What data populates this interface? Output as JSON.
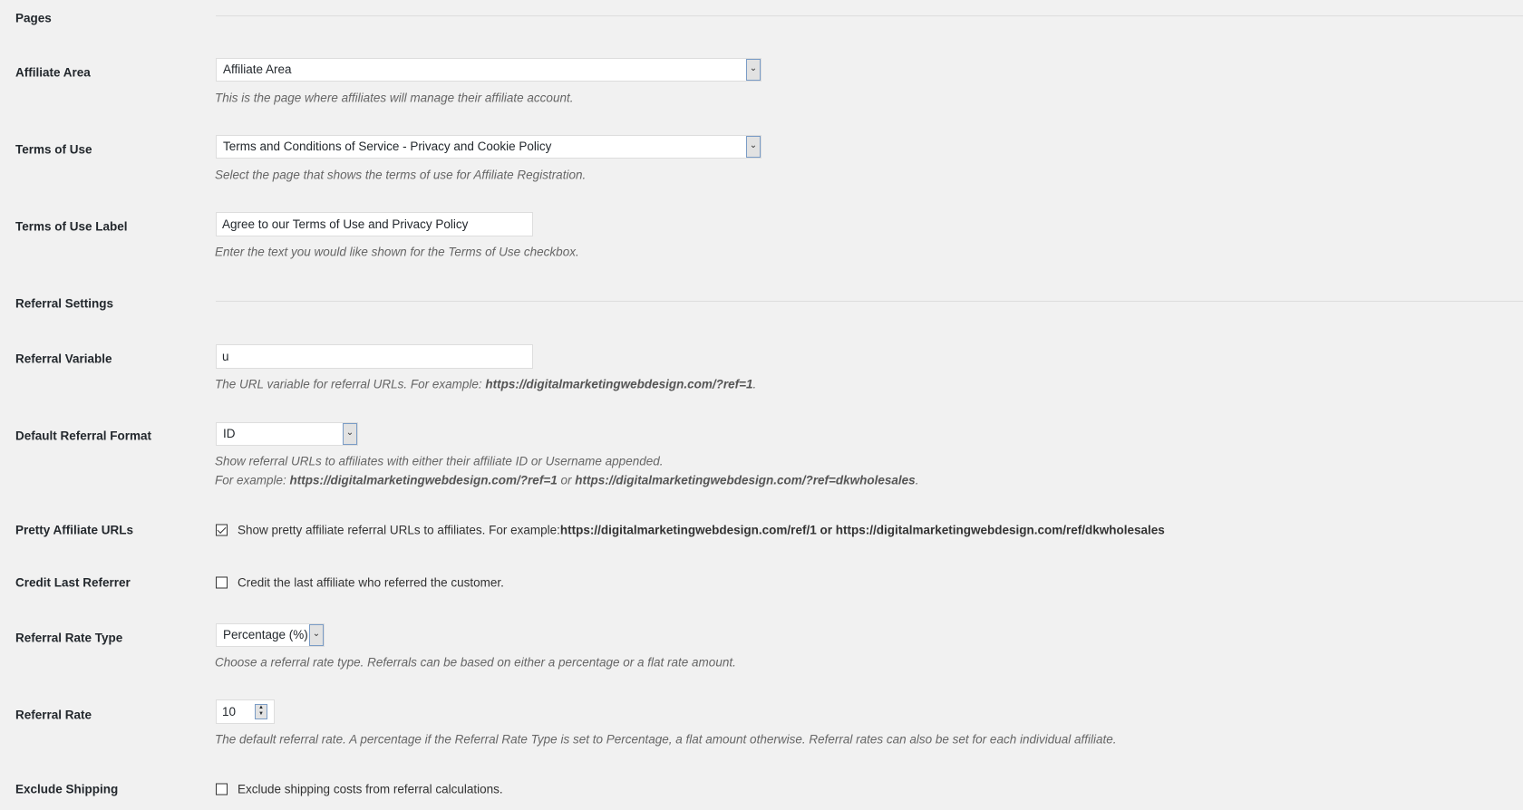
{
  "sections": {
    "pages": "Pages",
    "referral": "Referral Settings"
  },
  "affiliate_area": {
    "label": "Affiliate Area",
    "value": "Affiliate Area",
    "desc": "This is the page where affiliates will manage their affiliate account."
  },
  "terms": {
    "label": "Terms of Use",
    "value": "Terms and Conditions of Service - Privacy and Cookie Policy",
    "desc": "Select the page that shows the terms of use for Affiliate Registration."
  },
  "terms_label": {
    "label": "Terms of Use Label",
    "value": "Agree to our Terms of Use and Privacy Policy",
    "desc": "Enter the text you would like shown for the Terms of Use checkbox."
  },
  "ref_var": {
    "label": "Referral Variable",
    "value": "u",
    "desc": "The URL variable for referral URLs. For example: ",
    "url": "https://digitalmarketingwebdesign.com/?ref=1",
    "end": "."
  },
  "ref_format": {
    "label": "Default Referral Format",
    "value": "ID",
    "desc1": "Show referral URLs to affiliates with either their affiliate ID or Username appended.",
    "desc2_pre": "For example: ",
    "url1": "https://digitalmarketingwebdesign.com/?ref=1",
    "or": " or ",
    "url2": "https://digitalmarketingwebdesign.com/?ref=dkwholesales",
    "end": "."
  },
  "pretty": {
    "label": "Pretty Affiliate URLs",
    "checked": true,
    "text": "Show pretty affiliate referral URLs to affiliates. For example: ",
    "url1": "https://digitalmarketingwebdesign.com/ref/1",
    "or": " or ",
    "url2": "https://digitalmarketingwebdesign.com/ref/dkwholesales"
  },
  "credit": {
    "label": "Credit Last Referrer",
    "checked": false,
    "text": "Credit the last affiliate who referred the customer."
  },
  "rate_type": {
    "label": "Referral Rate Type",
    "value": "Percentage (%)",
    "desc": "Choose a referral rate type. Referrals can be based on either a percentage or a flat rate amount."
  },
  "rate": {
    "label": "Referral Rate",
    "value": "10",
    "desc": "The default referral rate. A percentage if the Referral Rate Type is set to Percentage, a flat amount otherwise. Referral rates can also be set for each individual affiliate."
  },
  "exclude": {
    "label": "Exclude Shipping",
    "checked": false,
    "text": "Exclude shipping costs from referral calculations."
  }
}
